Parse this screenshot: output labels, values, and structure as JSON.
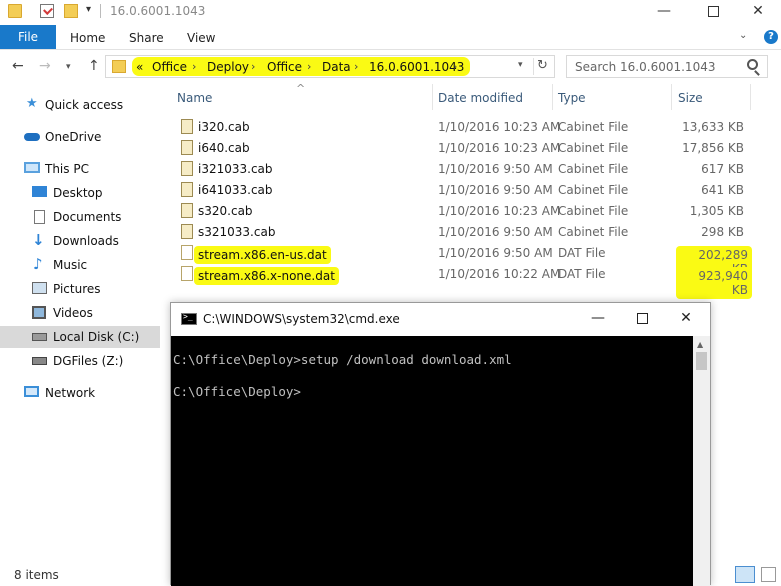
{
  "explorer": {
    "title": "16.0.6001.1043",
    "ribbon_tabs": {
      "file": "File",
      "home": "Home",
      "share": "Share",
      "view": "View"
    },
    "help": "?",
    "breadcrumb_prefix": "«",
    "breadcrumbs": [
      "Office",
      "Deploy",
      "Office",
      "Data",
      "16.0.6001.1043"
    ],
    "search_placeholder": "Search 16.0.6001.1043",
    "sidebar": [
      {
        "label": "Quick access",
        "icon": "star-icon"
      },
      {
        "label": "OneDrive",
        "icon": "cloud-icon"
      },
      {
        "label": "This PC",
        "icon": "computer-icon"
      },
      {
        "label": "Desktop",
        "icon": "desktop-icon"
      },
      {
        "label": "Documents",
        "icon": "document-icon"
      },
      {
        "label": "Downloads",
        "icon": "download-icon"
      },
      {
        "label": "Music",
        "icon": "music-icon"
      },
      {
        "label": "Pictures",
        "icon": "picture-icon"
      },
      {
        "label": "Videos",
        "icon": "video-icon"
      },
      {
        "label": "Local Disk (C:)",
        "icon": "drive-icon",
        "selected": true
      },
      {
        "label": "DGFiles (Z:)",
        "icon": "network-drive-icon"
      },
      {
        "label": "Network",
        "icon": "network-icon"
      }
    ],
    "columns": {
      "name": "Name",
      "date": "Date modified",
      "type": "Type",
      "size": "Size"
    },
    "files": [
      {
        "name": "i320.cab",
        "date": "1/10/2016 10:23 AM",
        "type": "Cabinet File",
        "size": "13,633 KB"
      },
      {
        "name": "i640.cab",
        "date": "1/10/2016 10:23 AM",
        "type": "Cabinet File",
        "size": "17,856 KB"
      },
      {
        "name": "i321033.cab",
        "date": "1/10/2016 9:50 AM",
        "type": "Cabinet File",
        "size": "617 KB"
      },
      {
        "name": "i641033.cab",
        "date": "1/10/2016 9:50 AM",
        "type": "Cabinet File",
        "size": "641 KB"
      },
      {
        "name": "s320.cab",
        "date": "1/10/2016 10:23 AM",
        "type": "Cabinet File",
        "size": "1,305 KB"
      },
      {
        "name": "s321033.cab",
        "date": "1/10/2016 9:50 AM",
        "type": "Cabinet File",
        "size": "298 KB"
      },
      {
        "name": "stream.x86.en-us.dat",
        "date": "1/10/2016 9:50 AM",
        "type": "DAT File",
        "size": "202,289 KB"
      },
      {
        "name": "stream.x86.x-none.dat",
        "date": "1/10/2016 10:22 AM",
        "type": "DAT File",
        "size": "923,940 KB"
      }
    ],
    "status": "8 items",
    "highlight_color": "#fafa14"
  },
  "cmd": {
    "title": "C:\\WINDOWS\\system32\\cmd.exe",
    "lines": [
      "C:\\Office\\Deploy>setup /download download.xml",
      "C:\\Office\\Deploy>"
    ]
  }
}
